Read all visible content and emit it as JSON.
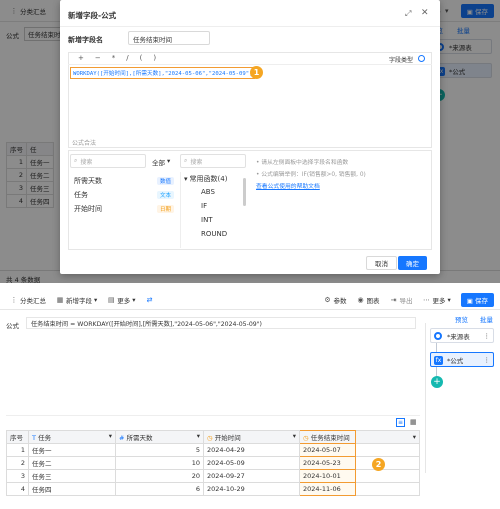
{
  "top": {
    "toolbar_left": "分类汇总",
    "toolbar_right": "多",
    "save": "保存",
    "preview": "预览",
    "batch": "批量",
    "formula_label": "公式",
    "formula_field": "任务结束时间",
    "source_node": "*来源表",
    "formula_node": "*公式",
    "table": {
      "headers": [
        "序号",
        "任"
      ],
      "rows": [
        [
          "1",
          "任务一"
        ],
        [
          "2",
          "任务二"
        ],
        [
          "3",
          "任务三"
        ],
        [
          "4",
          "任务四"
        ]
      ]
    },
    "footer": "共 4 条数据"
  },
  "dialog": {
    "title": "新增字段-公式",
    "field_name_label": "新增字段名",
    "field_name_value": "任务结束时间",
    "ops": [
      "+",
      "−",
      "*",
      "/",
      "(",
      ")"
    ],
    "field_type_label": "字段类型",
    "formula": "WORKDAY([开始时间],[所需天数],\"2024-05-06\",\"2024-05-09\")",
    "badge": "1",
    "formula_hint": "公式合法",
    "search1": "搜索",
    "all_label": "全部",
    "search2": "搜索",
    "fields": [
      {
        "name": "所需天数",
        "tag": "数值",
        "color": "#1677ff",
        "bg": "#e8f1ff"
      },
      {
        "name": "任务",
        "tag": "文本",
        "color": "#16a0ff",
        "bg": "#e8f6ff"
      },
      {
        "name": "开始时间",
        "tag": "日期",
        "color": "#f39c12",
        "bg": "#fff4e5"
      }
    ],
    "func_group": "常用函数(4)",
    "funcs": [
      "ABS",
      "IF",
      "INT",
      "ROUND"
    ],
    "help": [
      "请从左侧面板中选择字段名和函数",
      "公式编辑举例：IF(销售额>0, 销售额, 0)",
      "查看公式使用的帮助文档"
    ],
    "cancel": "取消",
    "ok": "确定"
  },
  "bottom": {
    "toolbar": [
      "分类汇总",
      "新增字段",
      "更多"
    ],
    "params": "参数",
    "chart": "图表",
    "export": "导出",
    "more": "更多",
    "save": "保存",
    "preview": "预览",
    "batch": "批量",
    "formula_label": "公式",
    "formula_text": "任务结束时间 = WORKDAY([开始时间],[所需天数],\"2024-05-06\",\"2024-05-09\")",
    "source_node": "*来源表",
    "formula_node": "*公式",
    "badge": "2",
    "table": {
      "headers": [
        "序号",
        "任务",
        "所需天数",
        "开始时间",
        "任务结束时间"
      ],
      "rows": [
        [
          "1",
          "任务一",
          "5",
          "2024-04-29",
          "2024-05-07"
        ],
        [
          "2",
          "任务二",
          "10",
          "2024-05-09",
          "2024-05-23"
        ],
        [
          "3",
          "任务三",
          "20",
          "2024-09-27",
          "2024-10-01"
        ],
        [
          "4",
          "任务四",
          "6",
          "2024-10-29",
          "2024-11-06"
        ]
      ]
    }
  }
}
